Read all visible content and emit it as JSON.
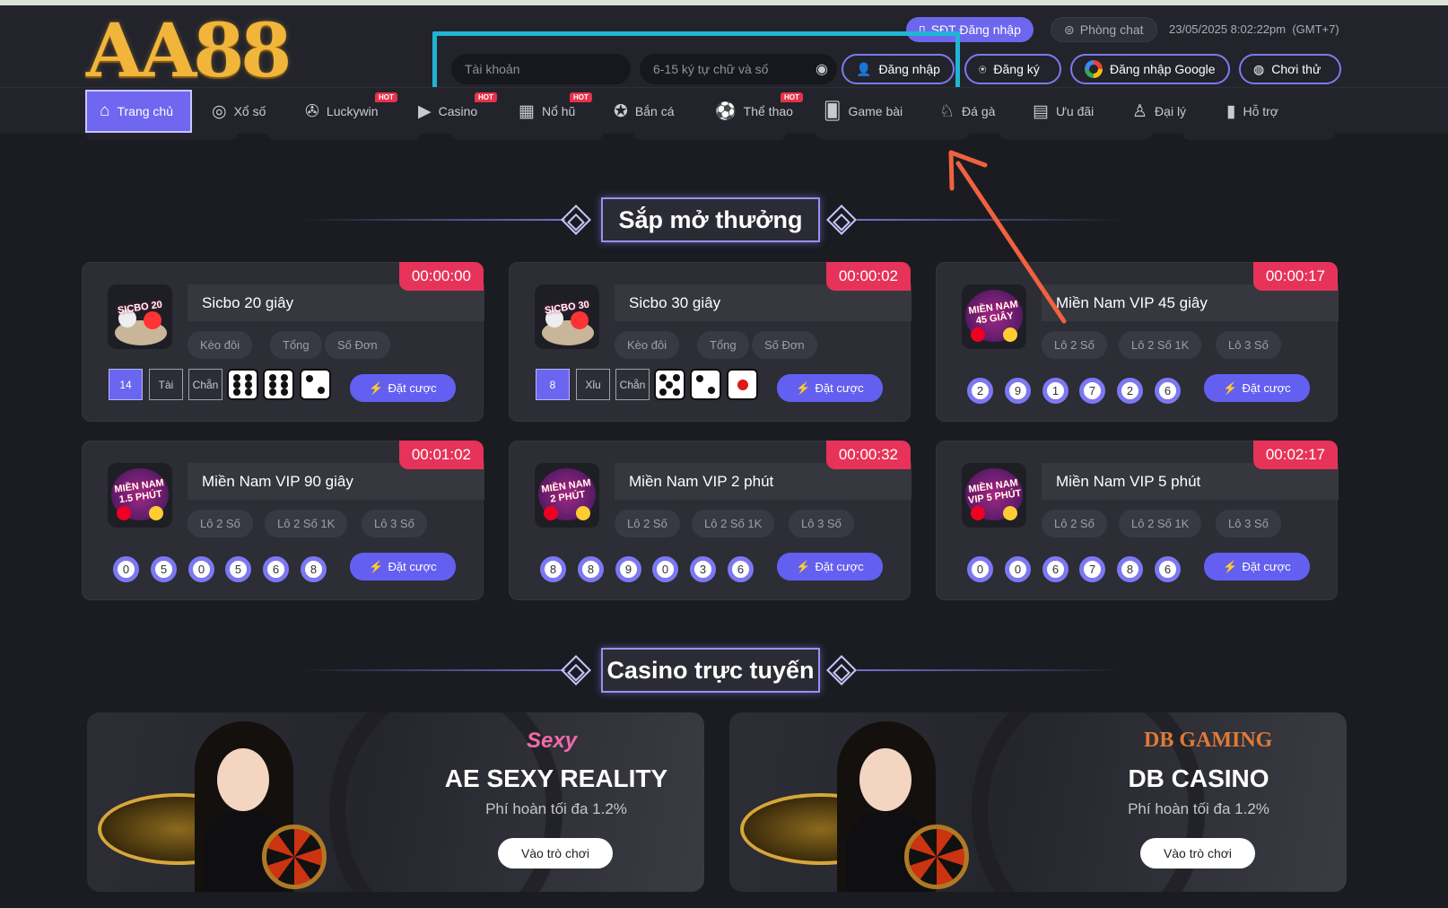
{
  "header": {
    "logo": "AA88",
    "sdt_login": "SĐT Đăng nhập",
    "chat": "Phòng chat",
    "datetime": "23/05/2025 8:02:22pm",
    "timezone": "(GMT+7)",
    "username_placeholder": "Tài khoản",
    "password_placeholder": "6-15 ký tự chữ và số",
    "login": "Đăng nhập",
    "register": "Đăng ký",
    "google_login": "Đăng nhập Google",
    "trial": "Chơi thử"
  },
  "nav": [
    {
      "label": "Trang chủ",
      "icon": "home-icon",
      "hot": false
    },
    {
      "label": "Xổ số",
      "icon": "lottery-icon",
      "hot": false
    },
    {
      "label": "Luckywin",
      "icon": "wheel-icon",
      "hot": true
    },
    {
      "label": "Casino",
      "icon": "play-icon",
      "hot": true
    },
    {
      "label": "Nổ hũ",
      "icon": "slot-icon",
      "hot": true
    },
    {
      "label": "Bắn cá",
      "icon": "fish-icon",
      "hot": false
    },
    {
      "label": "Thể thao",
      "icon": "ball-icon",
      "hot": true
    },
    {
      "label": "Game bài",
      "icon": "cards-icon",
      "hot": false
    },
    {
      "label": "Đá gà",
      "icon": "rooster-icon",
      "hot": false
    },
    {
      "label": "Ưu đãi",
      "icon": "gift-icon",
      "hot": false
    },
    {
      "label": "Đại lý",
      "icon": "agent-icon",
      "hot": false
    },
    {
      "label": "Hỗ trợ",
      "icon": "support-icon",
      "hot": false
    }
  ],
  "hot_label": "HOT",
  "upcoming": {
    "title": "Sắp mở thưởng",
    "bet_label": "Đặt cược",
    "games": [
      {
        "name": "Sicbo 20 giây",
        "thumb": "SICBO 20",
        "timer": "00:00:00",
        "tags": [
          "Kèo đôi",
          "Tổng",
          "Số Đơn"
        ],
        "total": "14",
        "result1": "Tài",
        "result2": "Chẵn",
        "dice": [
          6,
          6,
          2
        ]
      },
      {
        "name": "Sicbo 30 giây",
        "thumb": "SICBO 30",
        "timer": "00:00:02",
        "tags": [
          "Kèo đôi",
          "Tổng",
          "Số Đơn"
        ],
        "total": "8",
        "result1": "Xỉu",
        "result2": "Chẵn",
        "dice": [
          5,
          2,
          1
        ]
      },
      {
        "name": "Miền Nam VIP 45 giây",
        "thumb": "MIỀN NAM 45 GIÂY",
        "timer": "00:00:17",
        "tags": [
          "Lô 2 Số",
          "Lô 2 Số 1K",
          "Lô 3 Số"
        ],
        "balls": [
          "2",
          "9",
          "1",
          "7",
          "2",
          "6"
        ]
      },
      {
        "name": "Miền Nam VIP 90 giây",
        "thumb": "MIỀN NAM 1.5 PHÚT",
        "timer": "00:01:02",
        "tags": [
          "Lô 2 Số",
          "Lô 2 Số 1K",
          "Lô 3 Số"
        ],
        "balls": [
          "0",
          "5",
          "0",
          "5",
          "6",
          "8"
        ]
      },
      {
        "name": "Miền Nam VIP 2 phút",
        "thumb": "MIỀN NAM 2 PHÚT",
        "timer": "00:00:32",
        "tags": [
          "Lô 2 Số",
          "Lô 2 Số 1K",
          "Lô 3 Số"
        ],
        "balls": [
          "8",
          "8",
          "9",
          "0",
          "3",
          "6"
        ]
      },
      {
        "name": "Miền Nam VIP 5 phút",
        "thumb": "MIỀN NAM VIP 5 PHÚT",
        "timer": "00:02:17",
        "tags": [
          "Lô 2 Số",
          "Lô 2 Số 1K",
          "Lô 3 Số"
        ],
        "balls": [
          "0",
          "0",
          "6",
          "7",
          "8",
          "6"
        ]
      }
    ]
  },
  "casino": {
    "title": "Casino trực tuyến",
    "play_label": "Vào trò chơi",
    "banners": [
      {
        "brand": "Sexy",
        "name": "AE SEXY REALITY",
        "sub": "Phí hoàn tối đa 1.2%"
      },
      {
        "brand": "DB GAMING",
        "name": "DB CASINO",
        "sub": "Phí hoàn tối đa 1.2%"
      }
    ]
  },
  "colors": {
    "accent": "#6f67f0",
    "timer": "#e73359",
    "highlight": "#21b4d4",
    "arrow": "#f0623e"
  }
}
